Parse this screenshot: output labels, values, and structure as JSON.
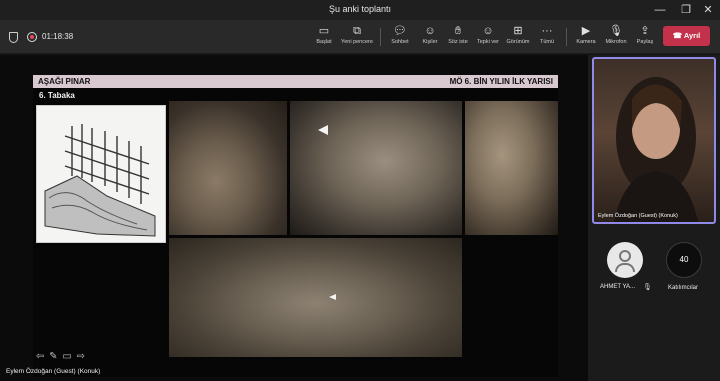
{
  "window": {
    "title": "Şu anki toplantı",
    "minimize": "—",
    "restore": "❐",
    "close": "✕"
  },
  "toolbar": {
    "timer": "01:18:38",
    "buttons": [
      {
        "label": "Başlat",
        "icon": "present-icon"
      },
      {
        "label": "Yeni pencere",
        "icon": "new-window-icon"
      },
      {
        "label": "Sohbet",
        "icon": "chat-icon"
      },
      {
        "label": "Kişiler",
        "icon": "people-icon"
      },
      {
        "label": "Söz iste",
        "icon": "raise-hand-icon"
      },
      {
        "label": "Tepki ver",
        "icon": "react-icon"
      },
      {
        "label": "Görünüm",
        "icon": "view-icon"
      },
      {
        "label": "Tümü",
        "icon": "more-icon"
      },
      {
        "label": "Kamera",
        "icon": "camera-icon"
      },
      {
        "label": "Mikrofon",
        "icon": "mic-icon"
      },
      {
        "label": "Paylaş",
        "icon": "share-icon"
      }
    ],
    "leave_label": "Ayrıl"
  },
  "slide": {
    "header_left": "AŞAĞI PINAR",
    "header_right": "MÖ 6. BİN YILIN İLK YARISI",
    "subtitle": "6. Tabaka"
  },
  "stage": {
    "presenter_label": "Eylem Özdoğan (Guest) (Konuk)"
  },
  "panel": {
    "video_name": "Eylem Özdoğan (Guest) (Konuk)",
    "participant_name": "AHMET YA...",
    "others_count": "40",
    "others_label": "Katılımcılar"
  },
  "colors": {
    "leave": "#c4314b",
    "speaker_border": "#8f89e8",
    "slide_header": "#d8c8cf"
  }
}
